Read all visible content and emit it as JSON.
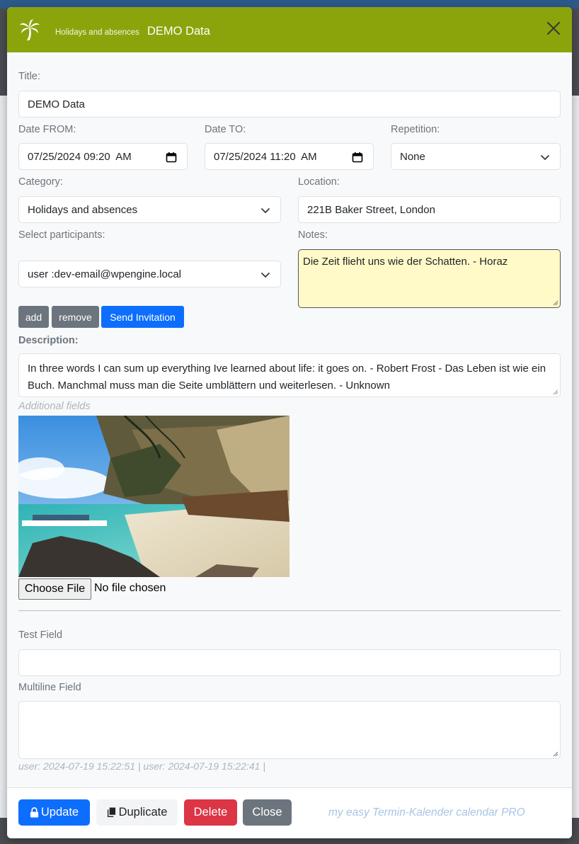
{
  "header": {
    "subtitle": "Holidays and absences",
    "title": "DEMO Data",
    "accent_color": "#8ca40c",
    "logo_icon": "palm-tree-icon",
    "close_icon": "close-icon"
  },
  "form": {
    "title_label": "Title:",
    "title_value": "DEMO Data",
    "date_from_label": "Date FROM:",
    "date_from_value": "07/25/2024 09:20  AM",
    "date_to_label": "Date TO:",
    "date_to_value": "07/25/2024 11:20  AM",
    "repetition_label": "Repetition:",
    "repetition_value": "None",
    "category_label": "Category:",
    "category_value": "Holidays and absences",
    "location_label": "Location:",
    "location_value": "221B Baker Street, London",
    "participants_label": "Select participants:",
    "participants_value": "user :dev-email@wpengine.local",
    "notes_label": "Notes:",
    "notes_value": "Die Zeit flieht uns wie der Schatten. - Horaz",
    "add_label": "add",
    "remove_label": "remove",
    "send_invitation_label": "Send Invitation",
    "description_label": "Description:",
    "description_value": "In three words I can sum up everything Ive learned about life: it goes on. - Robert Frost - Das Leben ist wie ein Buch. Manchmal muss man die Seite umblättern und weiterlesen. - Unknown",
    "additional_fields_label": "Additional fields",
    "choose_file_label": "Choose File",
    "no_file_label": "No file chosen",
    "test_field_label": "Test Field",
    "test_field_value": "",
    "multiline_label": "Multiline Field",
    "multiline_value": "",
    "audit_text": "user: 2024-07-19 15:22:51 | user: 2024-07-19 15:22:41 |"
  },
  "footer": {
    "update_label": "Update",
    "duplicate_label": "Duplicate",
    "delete_label": "Delete",
    "close_label": "Close",
    "brand_text": "my easy Termin-Kalender calendar PRO",
    "colors": {
      "update": "#0d6efd",
      "duplicate": "#f8f9fa",
      "delete": "#dc3545",
      "close": "#6c757d"
    }
  }
}
